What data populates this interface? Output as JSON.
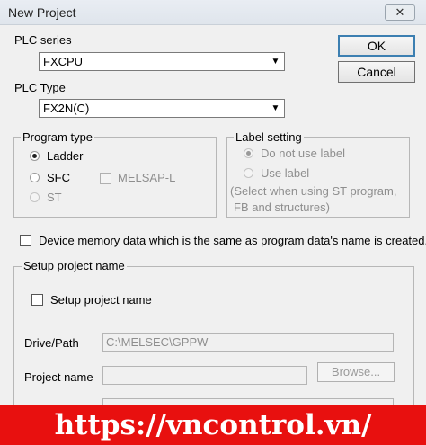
{
  "window": {
    "title": "New Project",
    "close_label": "✕"
  },
  "plc_series": {
    "label": "PLC series",
    "value": "FXCPU"
  },
  "plc_type": {
    "label": "PLC Type",
    "value": "FX2N(C)"
  },
  "buttons": {
    "ok": "OK",
    "cancel": "Cancel"
  },
  "program_type": {
    "title": "Program type",
    "ladder": "Ladder",
    "sfc": "SFC",
    "st": "ST",
    "melsap": "MELSAP-L",
    "selected": "Ladder"
  },
  "label_setting": {
    "title": "Label setting",
    "no_label": "Do not use label",
    "use_label": "Use label",
    "note_line1": "(Select when using ST program,",
    "note_line2": "FB and structures)"
  },
  "device_memory_check": "Device memory data which is the same as program data's name is created.",
  "setup": {
    "group_title": "Setup project name",
    "checkbox_label": "Setup project name",
    "drive_label": "Drive/Path",
    "drive_value": "C:\\MELSEC\\GPPW",
    "project_label": "Project name",
    "project_value": "",
    "browse": "Browse..."
  },
  "banner": "https://vncontrol.vn/"
}
